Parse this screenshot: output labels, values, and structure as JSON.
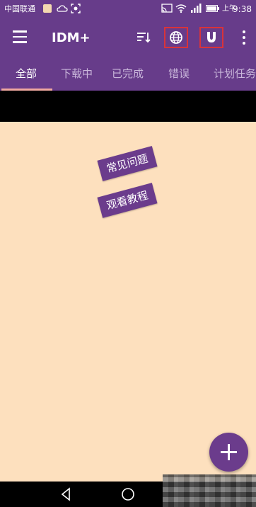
{
  "status_bar": {
    "carrier": "中国联通",
    "speed": "0K/s",
    "battery_label": "上午",
    "time": "9:38"
  },
  "app_bar": {
    "title": "IDM+",
    "actions": [
      "sort-icon",
      "browser-globe-icon",
      "magnet-icon",
      "more-vert-icon"
    ],
    "highlight_color": "#d9333a"
  },
  "tabs": [
    {
      "label": "全部",
      "active": true
    },
    {
      "label": "下载中",
      "active": false
    },
    {
      "label": "已完成",
      "active": false
    },
    {
      "label": "错误",
      "active": false
    },
    {
      "label": "计划任务",
      "active": false
    }
  ],
  "content": {
    "faq_label": "常见问题",
    "tutorial_label": "观看教程"
  },
  "colors": {
    "primary": "#673c8a",
    "background": "#fde0be",
    "tab_indicator": "#f0a9a0"
  }
}
